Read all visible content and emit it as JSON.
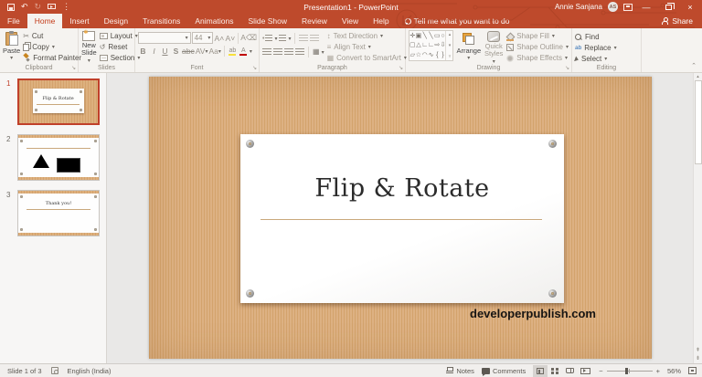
{
  "titlebar": {
    "title": "Presentation1 - PowerPoint",
    "user_name": "Annie Sanjana",
    "user_initials": "AS"
  },
  "tabs": [
    "File",
    "Home",
    "Insert",
    "Design",
    "Transitions",
    "Animations",
    "Slide Show",
    "Review",
    "View",
    "Help"
  ],
  "tell_me": "Tell me what you want to do",
  "share_label": "Share",
  "icons": {
    "undo": "↶",
    "redo": "↻",
    "more": "⋮",
    "minimize": "—",
    "close": "×",
    "caret_down": "▾",
    "scissors": "✂",
    "reset_arrow": "↺",
    "dialog_launcher": "↘",
    "scroll_up": "▴",
    "scroll_down": "▾",
    "more_shapes": "▿",
    "prev_slide": "⇞",
    "next_slide": "⇟",
    "collapse_ribbon": "⌃",
    "lines": "≡",
    "bullet": "•",
    "updown": "↕",
    "columns": "▦",
    "grow_font": "A˄",
    "shrink_font": "A˅",
    "clear_format": "A⌫",
    "zoom_out": "−",
    "zoom_in": "+"
  },
  "ribbon": {
    "clipboard": {
      "label": "Clipboard",
      "paste": "Paste",
      "cut": "Cut",
      "copy": "Copy",
      "format_painter": "Format Painter"
    },
    "slides": {
      "label": "Slides",
      "new_slide_line1": "New",
      "new_slide_line2": "Slide",
      "layout": "Layout",
      "reset": "Reset",
      "section": "Section"
    },
    "font": {
      "label": "Font",
      "size": "44",
      "bold": "B",
      "italic": "I",
      "underline": "U",
      "shadow": "S",
      "strikethrough": "abc",
      "spacing": "AV",
      "case": "Aa",
      "highlight": "ab",
      "color": "A"
    },
    "paragraph": {
      "label": "Paragraph",
      "text_direction": "Text Direction",
      "align_text": "Align Text",
      "convert": "Convert to SmartArt"
    },
    "drawing": {
      "label": "Drawing",
      "arrange": "Arrange",
      "quick1": "Quick",
      "quick2": "Styles",
      "shape_fill": "Shape Fill",
      "shape_outline": "Shape Outline",
      "shape_effects": "Shape Effects",
      "shapes": [
        "✛",
        "▣",
        "╲",
        "╲",
        "▭",
        "○",
        "▢",
        "△",
        "∟",
        "∟",
        "⇨",
        "⇩",
        "▱",
        "☆",
        "◠",
        "∿",
        "{",
        "}"
      ]
    },
    "editing": {
      "label": "Editing",
      "find": "Find",
      "replace": "Replace",
      "select": "Select"
    }
  },
  "thumbnails": [
    {
      "number": "1",
      "title": "Flip & Rotate"
    },
    {
      "number": "2"
    },
    {
      "number": "3",
      "title": "Thank you!"
    }
  ],
  "slide": {
    "title": "Flip & Rotate",
    "watermark": "developerpublish.com"
  },
  "status": {
    "slide_indicator": "Slide 1 of 3",
    "language": "English (India)",
    "notes": "Notes",
    "comments": "Comments",
    "zoom": "56%"
  },
  "colors": {
    "chrome": "#BE4A2C",
    "tab_active_text": "#C43E1C",
    "stripe_dark": "#D3A36C",
    "stripe_light": "#DDB183",
    "rule": "#C9A87C"
  }
}
